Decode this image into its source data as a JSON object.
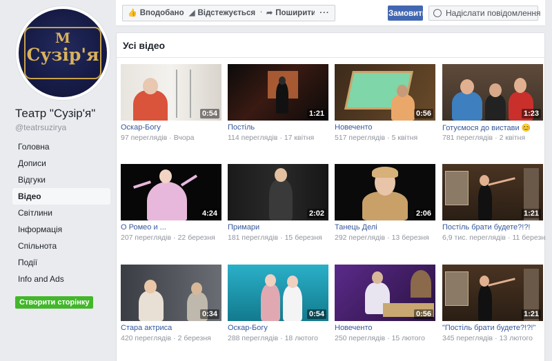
{
  "page": {
    "name": "Театр \"Сузір'я\"",
    "handle": "@teatrsuzirya",
    "logo_text": "Сузір'я",
    "logo_monogram": "М"
  },
  "nav": [
    {
      "label": "Головна",
      "active": false
    },
    {
      "label": "Дописи",
      "active": false
    },
    {
      "label": "Відгуки",
      "active": false
    },
    {
      "label": "Відео",
      "active": true
    },
    {
      "label": "Світлини",
      "active": false
    },
    {
      "label": "Інформація",
      "active": false
    },
    {
      "label": "Спільнота",
      "active": false
    },
    {
      "label": "Події",
      "active": false
    },
    {
      "label": "Info and Ads",
      "active": false
    }
  ],
  "create_page_label": "Створити сторінку",
  "actions": {
    "liked": "Вподобано",
    "following": "Відстежується",
    "share": "Поширити",
    "more": "···",
    "order": "Замовити",
    "message": "Надіслати повідомлення"
  },
  "section_title": "Усі відео",
  "videos": [
    {
      "title": "Оскар-Богу",
      "views": "97 переглядів",
      "date": "Вчора",
      "duration": "0:54",
      "icon": "woman-hanger-scene"
    },
    {
      "title": "Постіль",
      "views": "114 переглядів",
      "date": "17 квітня",
      "duration": "1:21",
      "icon": "dark-stage-scene"
    },
    {
      "title": "Новеченто",
      "views": "517 переглядів",
      "date": "5 квітня",
      "duration": "0:56",
      "icon": "green-frame-scene"
    },
    {
      "title": "Готуємося до вистави 😊",
      "views": "781 переглядів",
      "date": "2 квітня",
      "duration": "1:23",
      "icon": "group-photo-scene"
    },
    {
      "title": "О Ромео и ...",
      "views": "207 переглядів",
      "date": "22 березня",
      "duration": "4:24",
      "icon": "pink-dress-scene"
    },
    {
      "title": "Примари",
      "views": "181 переглядів",
      "date": "15 березня",
      "duration": "2:02",
      "icon": "black-dress-scene"
    },
    {
      "title": "Танець Делі",
      "views": "292 переглядів",
      "date": "13 березня",
      "duration": "2:06",
      "icon": "scarf-woman-scene"
    },
    {
      "title": "Постіль брати будете?!?!",
      "views": "6,9 тис. переглядів",
      "date": "11 березня",
      "duration": "1:21",
      "icon": "stage-actors-scene"
    },
    {
      "title": "Стара актриса",
      "views": "420 переглядів",
      "date": "2 березня",
      "duration": "0:34",
      "icon": "two-actresses-scene"
    },
    {
      "title": "Оскар-Богу",
      "views": "288 переглядів",
      "date": "18 лютого",
      "duration": "0:54",
      "icon": "cyan-stage-scene"
    },
    {
      "title": "Новеченто",
      "views": "250 переглядів",
      "date": "15 лютого",
      "duration": "0:56",
      "icon": "purple-piano-scene"
    },
    {
      "title": "\"Постіль брати будете?!?!\"",
      "views": "345 переглядів",
      "date": "13 лютого",
      "duration": "1:21",
      "icon": "stage-actors-scene"
    }
  ],
  "meta_separator": "·",
  "colors": {
    "link": "#365899",
    "brand_blue": "#4267b2",
    "create_green": "#42b72a",
    "logo_gold": "#d9b25b",
    "logo_navy": "#161b45"
  }
}
